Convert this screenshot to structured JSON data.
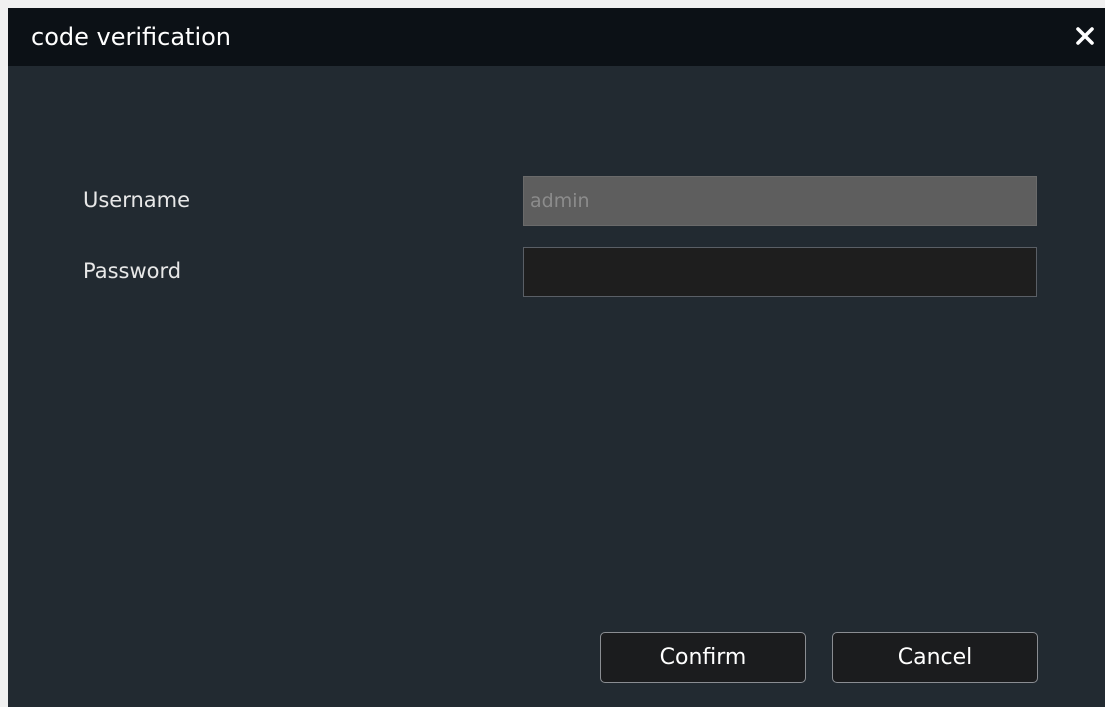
{
  "dialog": {
    "title": "code verification",
    "close_icon": "close-icon"
  },
  "form": {
    "username": {
      "label": "Username",
      "value": "admin"
    },
    "password": {
      "label": "Password",
      "value": ""
    }
  },
  "buttons": {
    "confirm_label": "Confirm",
    "cancel_label": "Cancel"
  },
  "colors": {
    "titlebar": "#0c1116",
    "body": "#222a31",
    "disabled_field": "#5e5e5e",
    "password_field": "#1e1e1e"
  }
}
